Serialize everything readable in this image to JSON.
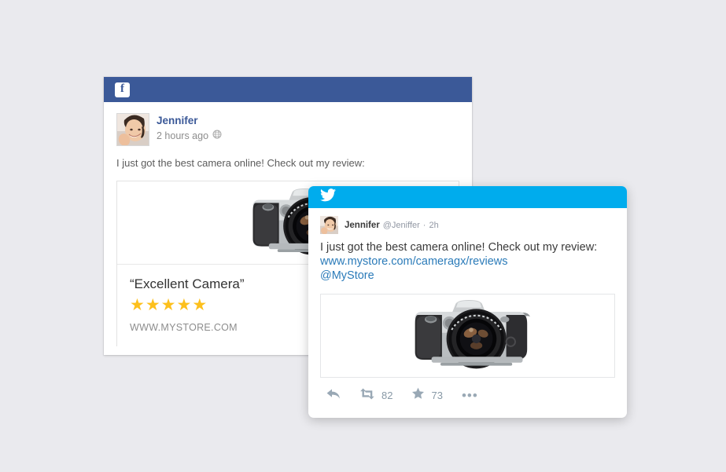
{
  "background_color": "#eaeaee",
  "facebook": {
    "brand_color": "#3b5998",
    "logo_glyph": "f",
    "post": {
      "author": "Jennifer",
      "timestamp": "2 hours ago",
      "privacy_icon": "globe-icon",
      "message": "I just got the best camera online! Check out my review:"
    },
    "attachment": {
      "image_alt": "dslr-camera-photo",
      "title": "“Excellent Camera”",
      "rating": 5,
      "rating_max": 5,
      "star_glyph": "★",
      "star_color": "#fdc01c",
      "url": "WWW.MYSTORE.COM"
    }
  },
  "twitter": {
    "brand_color": "#00aced",
    "logo_glyph": "twitter-bird",
    "tweet": {
      "author": "Jennifer",
      "handle": "@Jeniffer",
      "separator": "·",
      "age": "2h",
      "text": "I just got the best camera online! Check out my review:",
      "link": "www.mystore.com/cameragx/reviews",
      "mention": "@MyStore",
      "link_color": "#2b7bb9",
      "image_alt": "dslr-camera-photo"
    },
    "actions": {
      "reply_label": "",
      "retweet_count": "82",
      "favorite_count": "73",
      "more_label": "•••"
    }
  }
}
